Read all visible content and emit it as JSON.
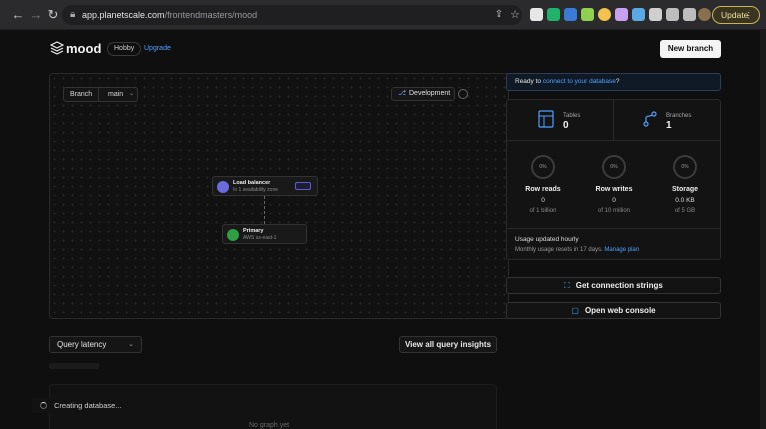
{
  "browser": {
    "url_host": "app.planetscale.com",
    "url_path": "/frontendmasters/mood",
    "update_label": "Update"
  },
  "header": {
    "app_name": "mood",
    "plan": "Hobby",
    "upgrade": "Upgrade",
    "new_branch": "New branch"
  },
  "diagram": {
    "branch_label": "Branch",
    "branch_value": "main",
    "environment": "Development",
    "nodes": {
      "load_balancer": {
        "title": "Load balancer",
        "subtitle": "In 1 availability zone"
      },
      "primary": {
        "title": "Primary",
        "subtitle": "AWS us-east-1"
      }
    }
  },
  "connect": {
    "prefix": "Ready to ",
    "link": "connect to your database",
    "suffix": "?"
  },
  "stats": {
    "tables": {
      "label": "Tables",
      "value": "0"
    },
    "branches": {
      "label": "Branches",
      "value": "1"
    },
    "gauges": [
      {
        "pct": "0%",
        "label": "Row reads",
        "value": "0",
        "of": "of 1 billion",
        "fraction": 0
      },
      {
        "pct": "0%",
        "label": "Row writes",
        "value": "0",
        "of": "of 10 million",
        "fraction": 0
      },
      {
        "pct": "0%",
        "label": "Storage",
        "value": "0.0 KB",
        "of": "of 5 GB",
        "fraction": 0
      }
    ],
    "usage_title": "Usage updated hourly",
    "usage_reset": "Monthly usage resets in 17 days. ",
    "manage_plan": "Manage plan"
  },
  "actions": {
    "connection_strings": "Get connection strings",
    "web_console": "Open web console"
  },
  "query": {
    "latency_select": "Query latency",
    "insights_button": "View all query insights",
    "no_graph": "No graph yet"
  },
  "toast": {
    "message": "Creating database..."
  },
  "icons": {
    "back": "arrow-left-icon",
    "forward": "arrow-right-icon",
    "reload": "reload-icon",
    "lock": "lock-icon",
    "share": "share-icon",
    "bookmark": "star-icon",
    "logo": "layers-icon",
    "tables": "table-icon",
    "branches": "branch-icon",
    "env": "branch-icon",
    "connect": "plug-icon",
    "console": "terminal-icon"
  },
  "colors": {
    "accent": "#4ea1ff",
    "primary_node": "#2ea043",
    "lb_node": "#6b6be0"
  }
}
